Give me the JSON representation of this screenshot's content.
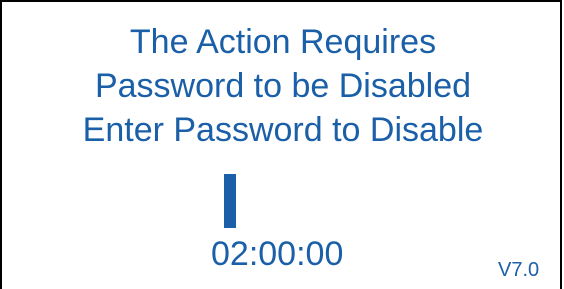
{
  "message": {
    "lines": [
      "The Action Requires",
      "Password to be Disabled",
      "Enter Password to Disable"
    ]
  },
  "password_entry": {
    "cursor": "text-cursor"
  },
  "timer": {
    "value": "02:00:00"
  },
  "version": {
    "label": "V7.0"
  },
  "colors": {
    "text": "#1a5fa8",
    "background": "#ffffff",
    "border": "#000000"
  }
}
